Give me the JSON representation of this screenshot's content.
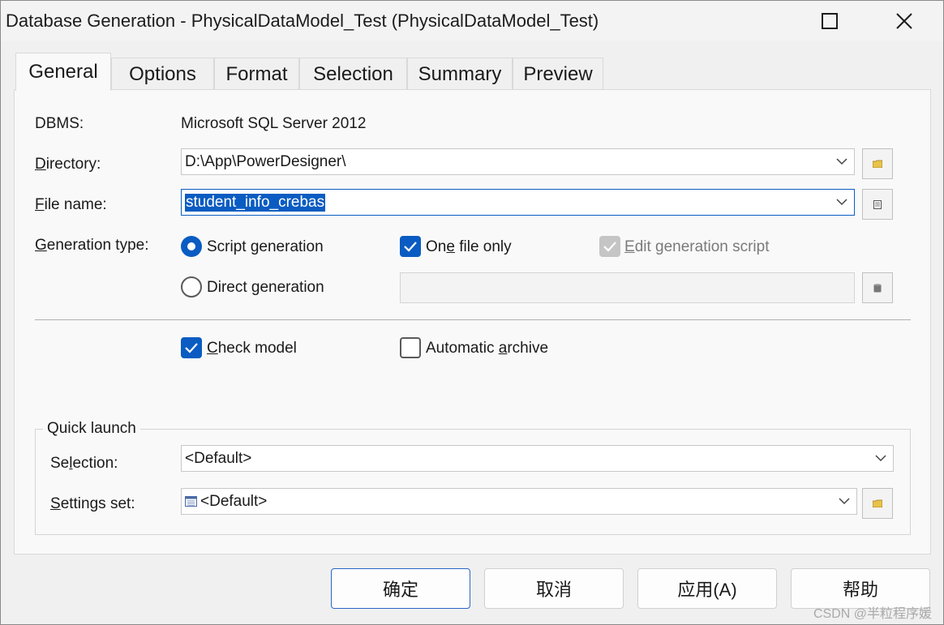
{
  "window": {
    "title": "Database Generation - PhysicalDataModel_Test (PhysicalDataModel_Test)",
    "controls": {
      "maximize_icon": "maximize-icon",
      "close_icon": "close-icon"
    }
  },
  "tabs": [
    {
      "label": "General",
      "active": true
    },
    {
      "label": "Options"
    },
    {
      "label": "Format"
    },
    {
      "label": "Selection"
    },
    {
      "label": "Summary"
    },
    {
      "label": "Preview"
    }
  ],
  "general": {
    "dbms_label": "DBMS:",
    "dbms_value": "Microsoft SQL Server 2012",
    "directory_label": "Directory:",
    "directory_value": "D:\\App\\PowerDesigner\\",
    "filename_label": "File name:",
    "filename_value": "student_info_crebas",
    "generation_type_label": "Generation type:",
    "script_generation": "Script generation",
    "direct_generation": "Direct generation",
    "one_file_only": "One file only",
    "edit_generation_script": "Edit generation script",
    "check_model": "Check model",
    "automatic_archive": "Automatic archive"
  },
  "quick_launch": {
    "title": "Quick launch",
    "selection_label": "Selection:",
    "selection_value": "<Default>",
    "settings_set_label": "Settings set:",
    "settings_set_value": "<Default>"
  },
  "buttons": {
    "ok": "确定",
    "cancel": "取消",
    "apply": "应用(A)",
    "help": "帮助"
  },
  "watermark": "CSDN @半粒程序媛",
  "colors": {
    "accent": "#0a5cc2"
  }
}
